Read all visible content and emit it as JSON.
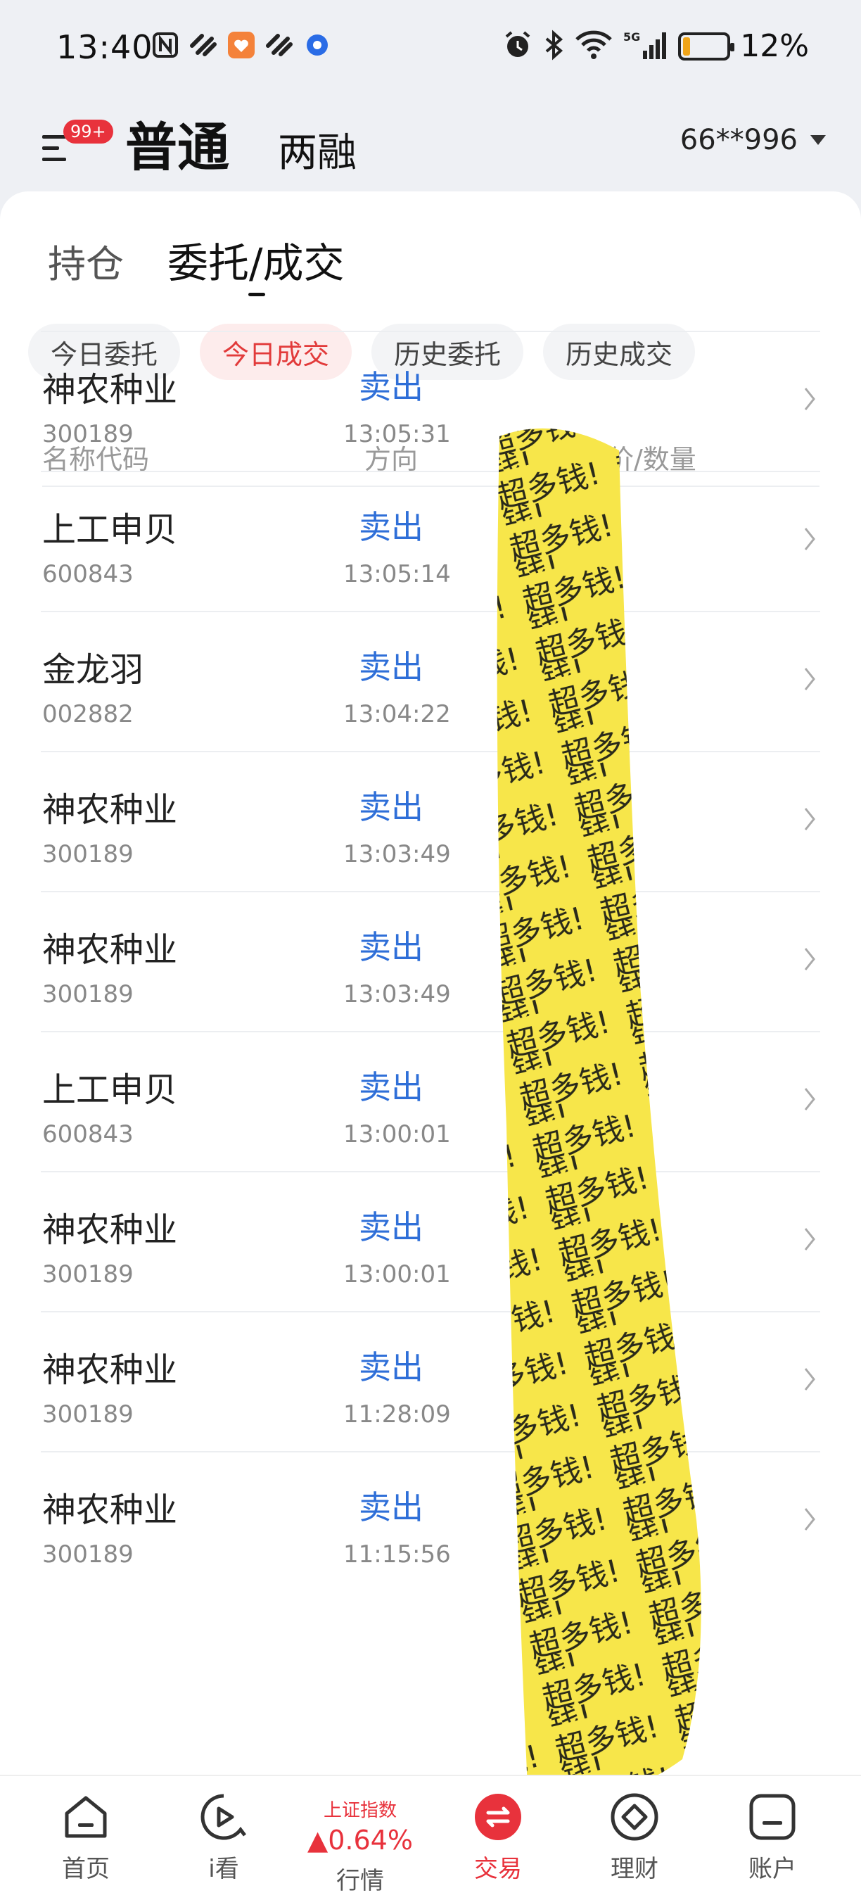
{
  "status_bar": {
    "time": "13:40",
    "battery_pct": "12%",
    "battery_level": 0.12,
    "icons": [
      "nfc-icon",
      "app-icon",
      "app-icon",
      "app-icon",
      "app-icon",
      "alarm-icon",
      "bluetooth-icon",
      "wifi-icon",
      "signal-5g-icon",
      "battery-icon"
    ]
  },
  "header": {
    "menu_badge": "99+",
    "tab_main": "普通",
    "tab_secondary": "两融",
    "account": "66**996"
  },
  "subtabs": {
    "hold": "持仓",
    "orders": "委托/成交"
  },
  "chips": [
    "今日委托",
    "今日成交",
    "历史委托",
    "历史成交"
  ],
  "active_chip_index": 1,
  "table": {
    "headers": {
      "name_code": "名称代码",
      "direction": "方向",
      "price_qty": "均价/数量"
    },
    "rows": [
      {
        "name": "神农种业",
        "code": "300189",
        "direction": "卖出",
        "time": "13:05:31"
      },
      {
        "name": "上工申贝",
        "code": "600843",
        "direction": "卖出",
        "time": "13:05:14"
      },
      {
        "name": "金龙羽",
        "code": "002882",
        "direction": "卖出",
        "time": "13:04:22"
      },
      {
        "name": "神农种业",
        "code": "300189",
        "direction": "卖出",
        "time": "13:03:49"
      },
      {
        "name": "神农种业",
        "code": "300189",
        "direction": "卖出",
        "time": "13:03:49"
      },
      {
        "name": "上工申贝",
        "code": "600843",
        "direction": "卖出",
        "time": "13:00:01"
      },
      {
        "name": "神农种业",
        "code": "300189",
        "direction": "卖出",
        "time": "13:00:01"
      },
      {
        "name": "神农种业",
        "code": "300189",
        "direction": "卖出",
        "time": "11:28:09"
      },
      {
        "name": "神农种业",
        "code": "300189",
        "direction": "卖出",
        "time": "11:15:56"
      }
    ]
  },
  "redaction_text": "超多钱!",
  "bottom_nav": {
    "home": "首页",
    "iwatch": "i看",
    "index_name": "上证指数",
    "index_change": "▲0.64%",
    "market": "行情",
    "trade": "交易",
    "finance": "理财",
    "account": "账户"
  },
  "colors": {
    "accent_red": "#e8323c",
    "sell_blue": "#2f6fd8",
    "redaction_yellow": "#f7e64a"
  }
}
